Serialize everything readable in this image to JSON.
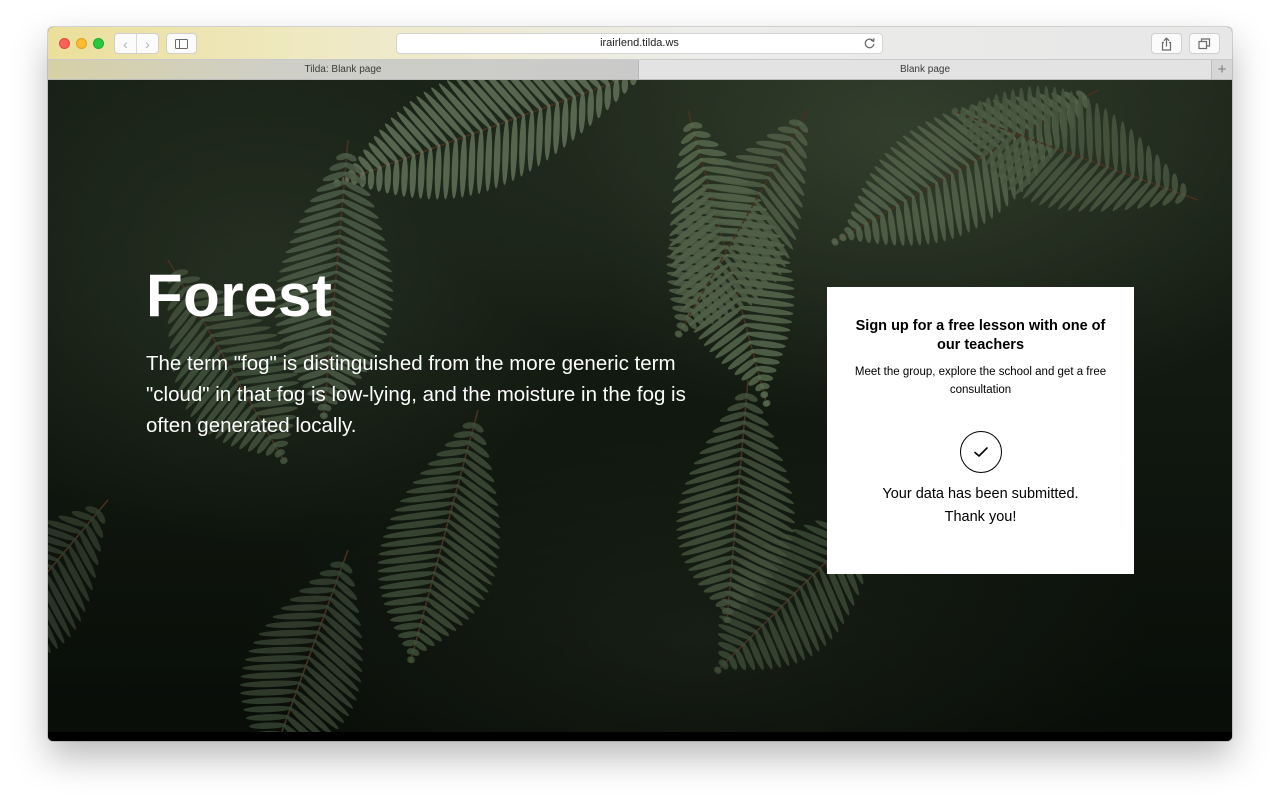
{
  "browser": {
    "url": "irairlend.tilda.ws",
    "tabs": [
      {
        "label": "Tilda: Blank page",
        "active": true
      },
      {
        "label": "Blank page",
        "active": false
      }
    ],
    "new_tab_label": "+",
    "back_glyph": "‹",
    "forward_glyph": "›",
    "icons": {
      "back": "chevron-left-icon",
      "forward": "chevron-right-icon",
      "sidebar": "sidebar-icon",
      "reload": "reload-icon",
      "share": "share-icon",
      "tabs": "tabs-overview-icon"
    }
  },
  "hero": {
    "title": "Forest",
    "text": "The term \"fog\" is distinguished from the more generic term \"cloud\" in that fog is low-lying, and the moisture in the fog is often generated locally."
  },
  "card": {
    "title": "Sign up for a free lesson with one of our teachers",
    "subtitle": "Meet the group, explore the school and get a free consultation",
    "icon": "checkmark-icon",
    "success_line1": "Your data has been submitted.",
    "success_line2": "Thank you!"
  },
  "colors": {
    "close": "#fc5f57",
    "minimize": "#fdbc2e",
    "zoom": "#29c840",
    "card_background": "#ffffff",
    "hero_text": "#ffffff"
  }
}
